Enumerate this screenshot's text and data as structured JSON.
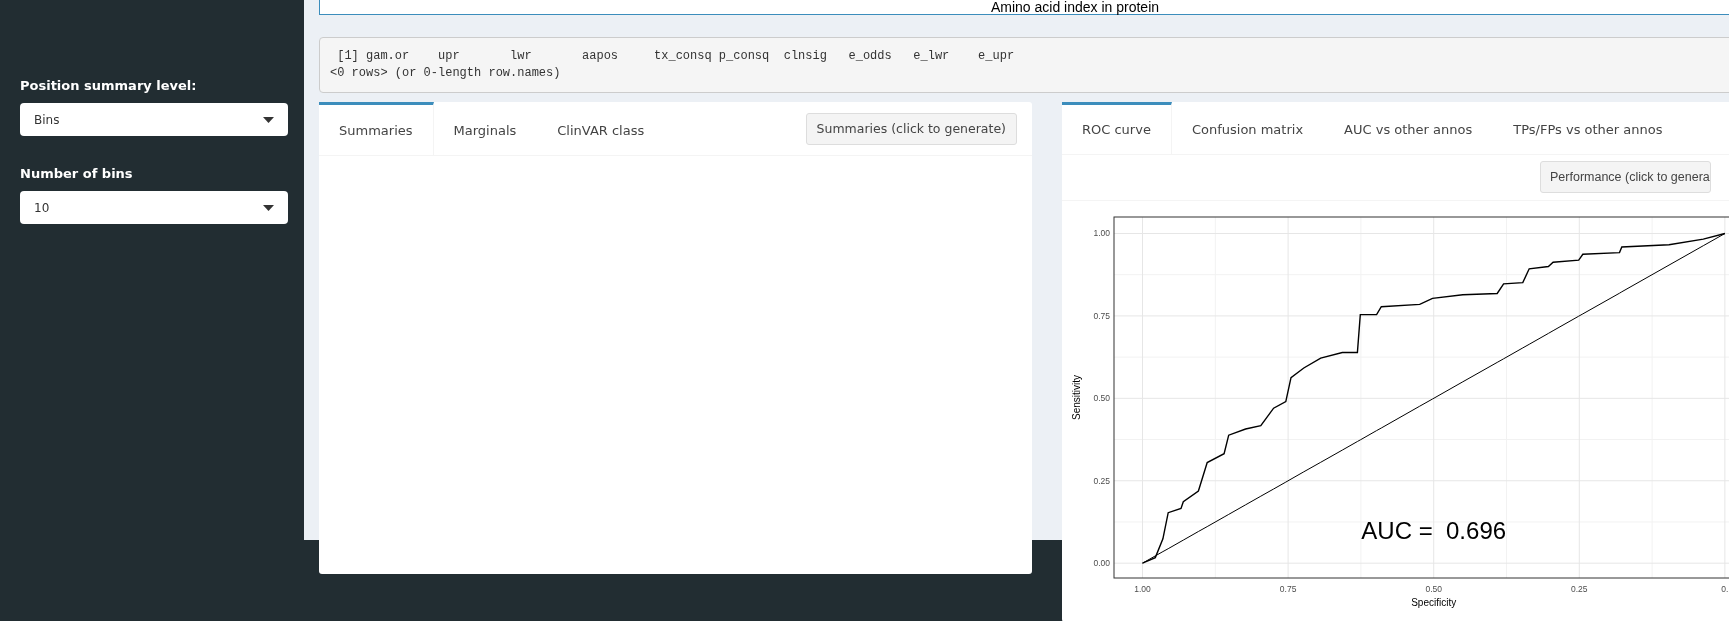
{
  "sidebar": {
    "fields": [
      {
        "label": "Position summary level:",
        "value": "Bins"
      },
      {
        "label": "Number of bins",
        "value": "10"
      }
    ]
  },
  "header": {
    "title": "Amino acid index in protein"
  },
  "console_output": [
    " [1] gam.or    upr       lwr       aapos     tx_consq p_consq  clnsig   e_odds   e_lwr    e_upr",
    "<0 rows> (or 0-length row.names)"
  ],
  "summary_panel": {
    "tabs": [
      {
        "label": "Summaries",
        "selected": true
      },
      {
        "label": "Marginals",
        "selected": false
      },
      {
        "label": "ClinVAR class",
        "selected": false
      }
    ],
    "button": "Summaries (click to generate)"
  },
  "performance_panel": {
    "tabs": [
      {
        "label": "ROC curve",
        "selected": true
      },
      {
        "label": "Confusion matrix",
        "selected": false
      },
      {
        "label": "AUC vs other annos",
        "selected": false
      },
      {
        "label": "TPs/FPs vs other annos",
        "selected": false
      }
    ],
    "button": "Performance (click to genera",
    "chart_data": {
      "type": "line",
      "xlabel": "Specificity",
      "ylabel": "Sensitivity",
      "x": [
        1,
        0.978,
        0.965,
        0.956,
        0.934,
        0.93,
        0.904,
        0.889,
        0.86,
        0.852,
        0.823,
        0.797,
        0.775,
        0.754,
        0.745,
        0.723,
        0.694,
        0.657,
        0.631,
        0.626,
        0.598,
        0.59,
        0.524,
        0.502,
        0.45,
        0.391,
        0.38,
        0.347,
        0.336,
        0.303,
        0.295,
        0.251,
        0.244,
        0.181,
        0.177,
        0.096,
        0.037,
        0
      ],
      "grid": true,
      "series": [
        {
          "color": "#000000",
          "values": [
            0,
            0.017,
            0.074,
            0.153,
            0.166,
            0.186,
            0.219,
            0.305,
            0.332,
            0.388,
            0.407,
            0.417,
            0.47,
            0.49,
            0.563,
            0.592,
            0.622,
            0.639,
            0.639,
            0.754,
            0.754,
            0.778,
            0.785,
            0.803,
            0.814,
            0.818,
            0.847,
            0.851,
            0.893,
            0.9,
            0.913,
            0.919,
            0.937,
            0.942,
            0.959,
            0.966,
            0.983,
            1
          ]
        },
        {
          "color": "#000000",
          "values": [
            0,
            0.022,
            0.035,
            0.044,
            0.066,
            0.07,
            0.096,
            0.111,
            0.14,
            0.148,
            0.177,
            0.203,
            0.225,
            0.246,
            0.255,
            0.277,
            0.306,
            0.343,
            0.369,
            0.374,
            0.402,
            0.41,
            0.476,
            0.498,
            0.55,
            0.609,
            0.62,
            0.653,
            0.664,
            0.697,
            0.705,
            0.749,
            0.756,
            0.819,
            0.823,
            0.904,
            0.963,
            1
          ]
        }
      ],
      "xlim": [
        1.049,
        -0.05
      ],
      "ylim": [
        -0.045,
        1.05
      ],
      "xticks": [
        {
          "value": 1,
          "label": "1.00"
        },
        {
          "value": 0.75,
          "label": "0.75"
        },
        {
          "value": 0.5,
          "label": "0.50"
        },
        {
          "value": 0.25,
          "label": "0.25"
        },
        {
          "value": 0,
          "label": "0."
        }
      ],
      "yticks": [
        {
          "value": 0,
          "label": "0.00"
        },
        {
          "value": 0.25,
          "label": "0.25"
        },
        {
          "value": 0.5,
          "label": "0.50"
        },
        {
          "value": 0.75,
          "label": "0.75"
        },
        {
          "value": 1,
          "label": "1.00"
        }
      ],
      "annotations": [
        "AUC =  0.696"
      ]
    }
  }
}
